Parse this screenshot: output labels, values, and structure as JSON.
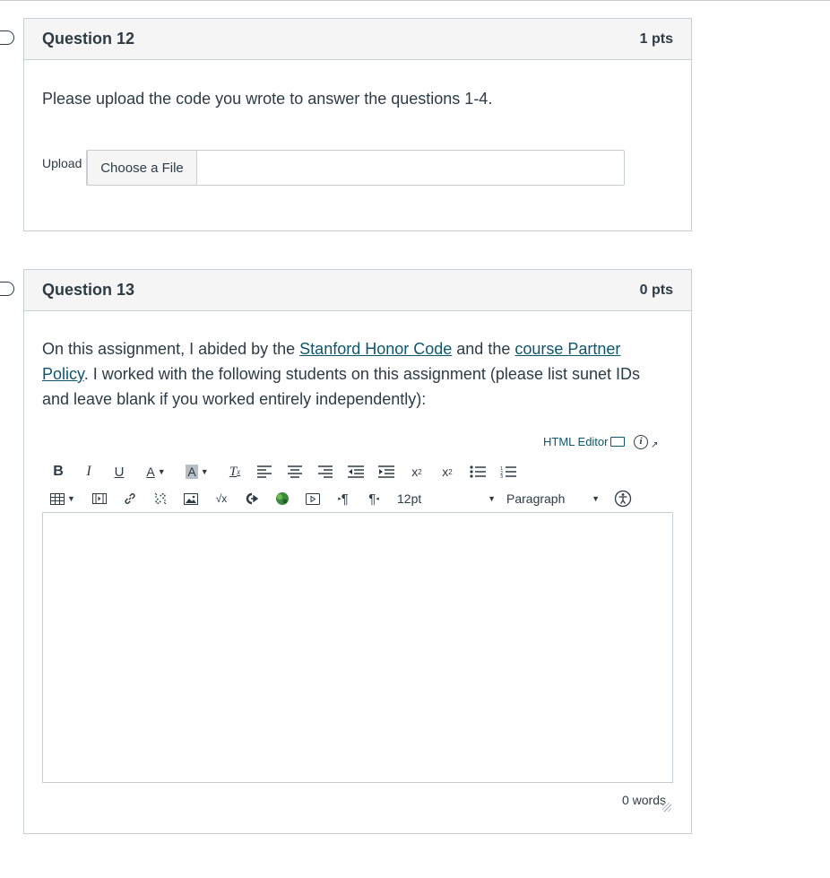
{
  "questions": [
    {
      "title": "Question 12",
      "points": "1 pts",
      "text": "Please upload the code you wrote to answer the questions 1-4.",
      "upload_label": "Upload",
      "choose_file_label": "Choose a File"
    },
    {
      "title": "Question 13",
      "points": "0 pts",
      "text_before_link1": "On this assignment, I abided by the ",
      "link1": "Stanford Honor Code",
      "text_between_links": " and the ",
      "link2": "course Partner Policy",
      "text_after_link2": ". I worked with the following students on this assignment (please list sunet IDs and leave blank if you worked entirely independently):",
      "html_editor_label": "HTML Editor",
      "font_size_value": "12pt",
      "block_format_value": "Paragraph",
      "word_count": "0 words"
    }
  ],
  "toolbar": {
    "row1_icons": [
      "bold-icon",
      "italic-icon",
      "underline-icon",
      "text-color-icon",
      "background-color-icon",
      "clear-formatting-icon",
      "align-left-icon",
      "align-center-icon",
      "align-right-icon",
      "outdent-icon",
      "indent-icon",
      "superscript-icon",
      "subscript-icon",
      "bullet-list-icon",
      "numbered-list-icon"
    ],
    "row2_icons": [
      "table-icon",
      "media-icon",
      "link-icon",
      "unlink-icon",
      "image-icon",
      "math-equation-icon",
      "lti-tool-icon",
      "google-drive-icon",
      "embed-media-icon",
      "ltr-icon",
      "rtl-icon",
      "accessibility-checker-icon"
    ]
  },
  "colors": {
    "text": "#2d3b45",
    "link": "#0e566c",
    "border": "#c7cdd1",
    "header_bg": "#f5f5f5"
  }
}
